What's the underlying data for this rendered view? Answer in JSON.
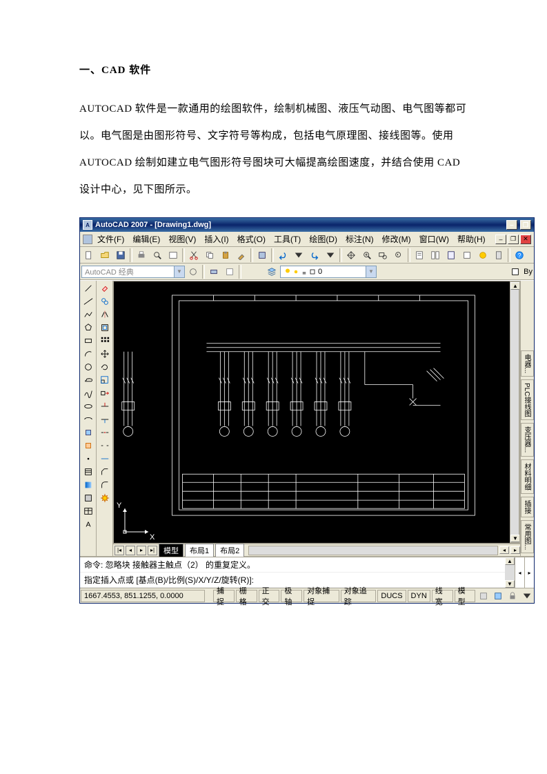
{
  "doc": {
    "heading": "一、CAD 软件",
    "body": "AUTOCAD 软件是一款通用的绘图软件，绘制机械图、液压气动图、电气图等都可以。电气图是由图形符号、文字符号等构成，包括电气原理图、接线图等。使用 AUTOCAD 绘制如建立电气图形符号图块可大幅提高绘图速度，并结合使用 CAD 设计中心，见下图所示。"
  },
  "window": {
    "title": "AutoCAD 2007 - [Drawing1.dwg]"
  },
  "menus": [
    "文件(F)",
    "编辑(E)",
    "视图(V)",
    "插入(I)",
    "格式(O)",
    "工具(T)",
    "绘图(D)",
    "标注(N)",
    "修改(M)",
    "窗口(W)",
    "帮助(H)"
  ],
  "workspace": {
    "label": "AutoCAD 经典"
  },
  "layer_value": "0",
  "tabs": {
    "active": "模型",
    "others": [
      "布局1",
      "布局2"
    ]
  },
  "right_tabs": [
    "常用图...",
    "插接",
    "材料明细",
    "变压器...",
    "PLC接线图",
    "电器..."
  ],
  "cmd": {
    "l1": "命令:  忽略块 接触器主触点（2） 的重复定义。",
    "l2": "指定插入点或 [基点(B)/比例(S)/X/Y/Z/旋转(R)]:"
  },
  "status": {
    "coords": "1667.4553, 851.1255, 0.0000",
    "items": [
      "捕捉",
      "栅格",
      "正交",
      "极轴",
      "对象捕捉",
      "对象追踪",
      "DUCS",
      "DYN",
      "线宽",
      "模型"
    ]
  },
  "ucs": {
    "x": "X",
    "y": "Y"
  },
  "by_label": "By"
}
